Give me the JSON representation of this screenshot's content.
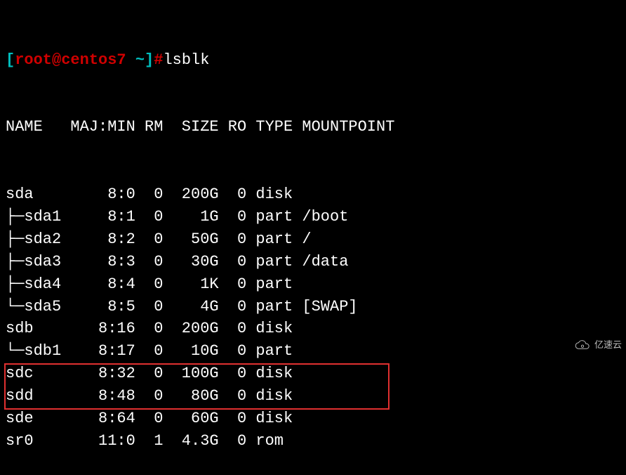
{
  "prompt": {
    "open": "[",
    "user": "root",
    "at": "@",
    "host": "centos7",
    "path": " ~",
    "close": "]",
    "hash": "#"
  },
  "command": "lsblk",
  "headers": {
    "name": "NAME",
    "maj": "MAJ:MIN",
    "rm": "RM",
    "size": "SIZE",
    "ro": "RO",
    "type": "TYPE",
    "mount": "MOUNTPOINT"
  },
  "rows": [
    {
      "name": "sda",
      "maj": "8:0",
      "rm": "0",
      "size": "200G",
      "ro": "0",
      "type": "disk",
      "mount": "",
      "hl": false
    },
    {
      "name": "├─sda1",
      "maj": "8:1",
      "rm": "0",
      "size": "1G",
      "ro": "0",
      "type": "part",
      "mount": "/boot",
      "hl": false
    },
    {
      "name": "├─sda2",
      "maj": "8:2",
      "rm": "0",
      "size": "50G",
      "ro": "0",
      "type": "part",
      "mount": "/",
      "hl": false
    },
    {
      "name": "├─sda3",
      "maj": "8:3",
      "rm": "0",
      "size": "30G",
      "ro": "0",
      "type": "part",
      "mount": "/data",
      "hl": false
    },
    {
      "name": "├─sda4",
      "maj": "8:4",
      "rm": "0",
      "size": "1K",
      "ro": "0",
      "type": "part",
      "mount": "",
      "hl": false
    },
    {
      "name": "└─sda5",
      "maj": "8:5",
      "rm": "0",
      "size": "4G",
      "ro": "0",
      "type": "part",
      "mount": "[SWAP]",
      "hl": false
    },
    {
      "name": "sdb",
      "maj": "8:16",
      "rm": "0",
      "size": "200G",
      "ro": "0",
      "type": "disk",
      "mount": "",
      "hl": false
    },
    {
      "name": "└─sdb1",
      "maj": "8:17",
      "rm": "0",
      "size": "10G",
      "ro": "0",
      "type": "part",
      "mount": "",
      "hl": false
    },
    {
      "name": "sdc",
      "maj": "8:32",
      "rm": "0",
      "size": "100G",
      "ro": "0",
      "type": "disk",
      "mount": "",
      "hl": true
    },
    {
      "name": "sdd",
      "maj": "8:48",
      "rm": "0",
      "size": "80G",
      "ro": "0",
      "type": "disk",
      "mount": "",
      "hl": true
    },
    {
      "name": "sde",
      "maj": "8:64",
      "rm": "0",
      "size": "60G",
      "ro": "0",
      "type": "disk",
      "mount": "",
      "hl": false
    },
    {
      "name": "sr0",
      "maj": "11:0",
      "rm": "1",
      "size": "4.3G",
      "ro": "0",
      "type": "rom",
      "mount": "",
      "hl": false
    }
  ],
  "watermark": "亿速云"
}
